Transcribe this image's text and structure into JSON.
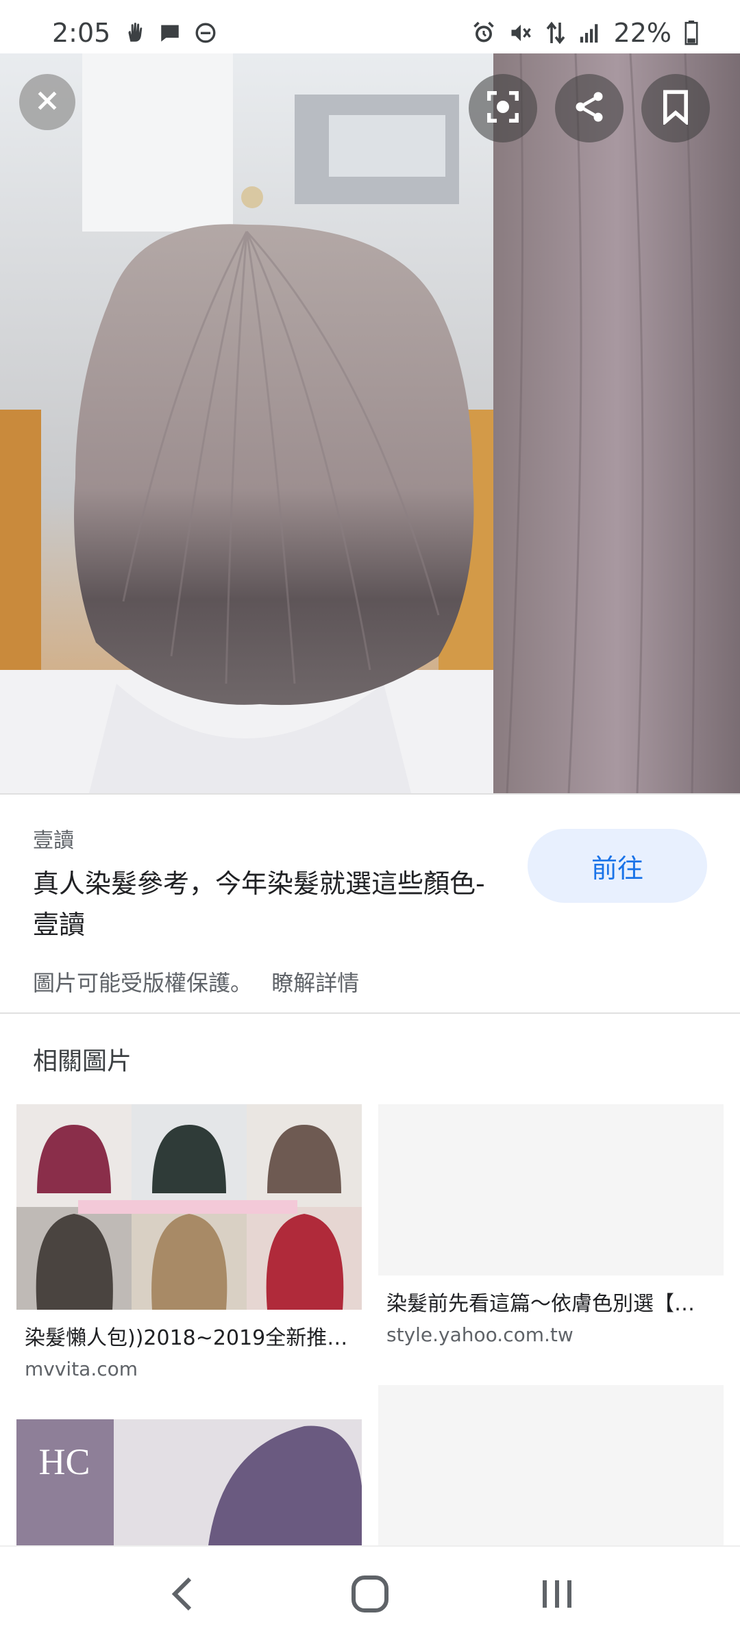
{
  "status_bar": {
    "time": "2:05",
    "battery": "22%",
    "icons": [
      "hand-icon",
      "message-icon",
      "dnd-icon",
      "alarm-icon",
      "mute-icon",
      "data-icon",
      "signal-icon",
      "battery-icon"
    ]
  },
  "viewer": {
    "close_icon": "close-icon",
    "actions": [
      "lens-icon",
      "share-icon",
      "bookmark-icon"
    ]
  },
  "result": {
    "source": "壹讀",
    "title": "真人染髮參考，今年染髮就選這些顏色- 壹讀",
    "visit_label": "前往",
    "copyright_text": "圖片可能受版權保護。",
    "learn_more": "瞭解詳情"
  },
  "related": {
    "heading": "相關圖片",
    "items": [
      {
        "caption": "染髮懶人包))2018~2019全新推…",
        "domain": "mvvita.com"
      },
      {
        "caption": "染髮前先看這篇～依膚色別選【…",
        "domain": "style.yahoo.com.tw"
      },
      {
        "caption": "",
        "domain": ""
      },
      {
        "caption": "",
        "domain": ""
      }
    ],
    "thumb_overlay_text": "HC"
  },
  "colors": {
    "accent": "#1a73e8",
    "accent_bg": "#e8f0fe"
  }
}
